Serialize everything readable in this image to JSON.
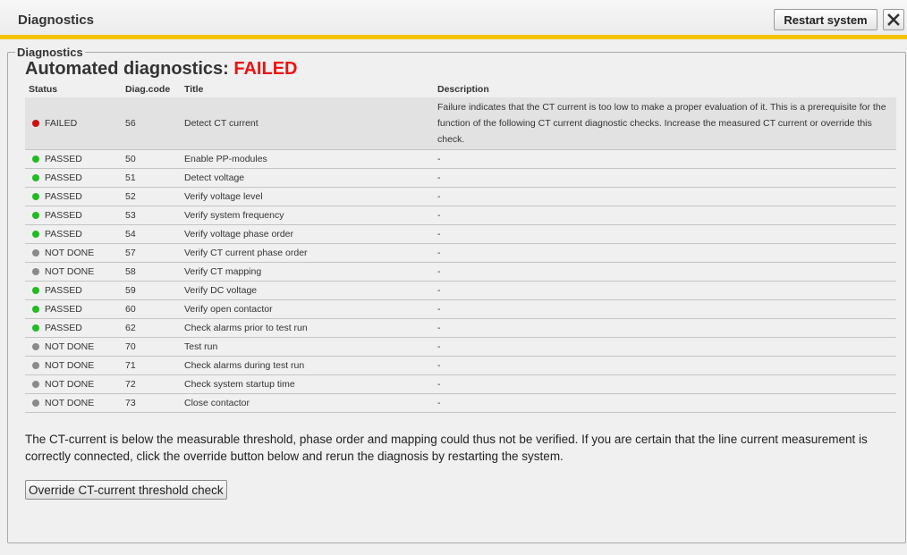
{
  "header": {
    "title": "Diagnostics",
    "restart_label": "Restart system"
  },
  "panel": {
    "legend": "Diagnostics",
    "heading_prefix": "Automated diagnostics: ",
    "heading_status": "FAILED"
  },
  "colors": {
    "accent": "#f5c400",
    "failed": "#cc1111",
    "passed": "#22bb22",
    "not_done": "#8a8a8a"
  },
  "table": {
    "headers": [
      "Status",
      "Diag.code",
      "Title",
      "Description"
    ],
    "rows": [
      {
        "status": "FAILED",
        "code": "56",
        "title": "Detect CT current",
        "description": "Failure indicates that the CT current is too low to make a proper evaluation of it. This is a prerequisite for the function of the following CT current diagnostic checks. Increase the measured CT current or override this check."
      },
      {
        "status": "PASSED",
        "code": "50",
        "title": "Enable PP-modules",
        "description": "-"
      },
      {
        "status": "PASSED",
        "code": "51",
        "title": "Detect voltage",
        "description": "-"
      },
      {
        "status": "PASSED",
        "code": "52",
        "title": "Verify voltage level",
        "description": "-"
      },
      {
        "status": "PASSED",
        "code": "53",
        "title": "Verify system frequency",
        "description": "-"
      },
      {
        "status": "PASSED",
        "code": "54",
        "title": "Verify voltage phase order",
        "description": "-"
      },
      {
        "status": "NOT DONE",
        "code": "57",
        "title": "Verify CT current phase order",
        "description": "-"
      },
      {
        "status": "NOT DONE",
        "code": "58",
        "title": "Verify CT mapping",
        "description": "-"
      },
      {
        "status": "PASSED",
        "code": "59",
        "title": "Verify DC voltage",
        "description": "-"
      },
      {
        "status": "PASSED",
        "code": "60",
        "title": "Verify open contactor",
        "description": "-"
      },
      {
        "status": "PASSED",
        "code": "62",
        "title": "Check alarms prior to test run",
        "description": "-"
      },
      {
        "status": "NOT DONE",
        "code": "70",
        "title": "Test run",
        "description": "-"
      },
      {
        "status": "NOT DONE",
        "code": "71",
        "title": "Check alarms during test run",
        "description": "-"
      },
      {
        "status": "NOT DONE",
        "code": "72",
        "title": "Check system startup time",
        "description": "-"
      },
      {
        "status": "NOT DONE",
        "code": "73",
        "title": "Close contactor",
        "description": "-"
      }
    ]
  },
  "note": "The CT-current is below the measurable threshold, phase order and mapping could thus not be verified. If you are certain that the line current measurement is correctly connected, click the override button below and rerun the diagnosis by restarting the system.",
  "override_label": "Override CT-current threshold check"
}
